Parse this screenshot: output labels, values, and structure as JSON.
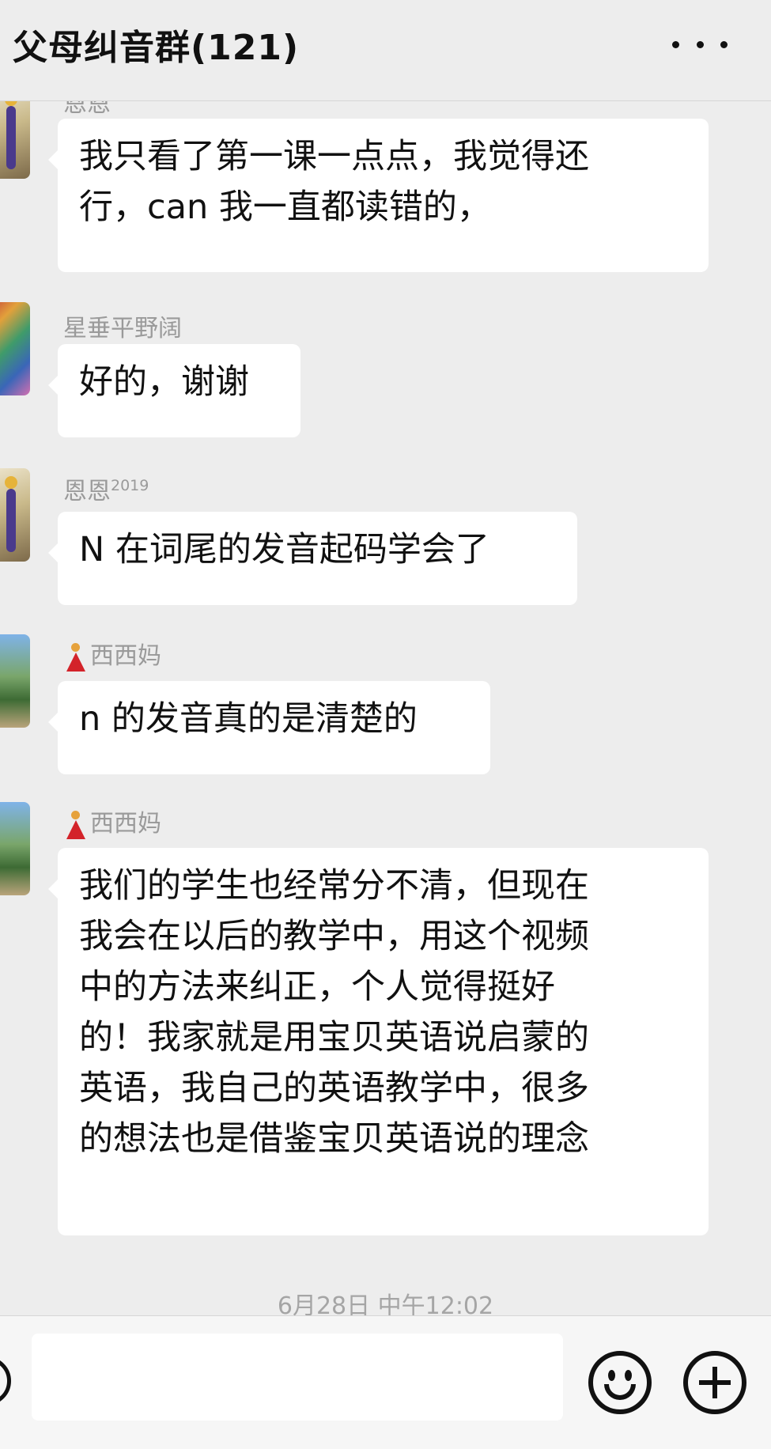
{
  "header": {
    "title": "父母纠音群(121)",
    "more_icon": "more-dots-icon"
  },
  "messages": [
    {
      "sender": "恩恩",
      "sender_sup": "",
      "sender_emoji": "",
      "text": "我只看了第一课一点点，我觉得还\n行，can 我一直都读错的，",
      "avatar": "avatar-figure"
    },
    {
      "sender": "星垂平野阔",
      "sender_sup": "",
      "sender_emoji": "",
      "text": "好的，谢谢",
      "avatar": "avatar-artwork"
    },
    {
      "sender": "恩恩",
      "sender_sup": "2019",
      "sender_emoji": "",
      "text": "N 在词尾的发音起码学会了",
      "avatar": "avatar-figure"
    },
    {
      "sender": "西西妈",
      "sender_sup": "",
      "sender_emoji": "dancer-emoji",
      "text": "n 的发音真的是清楚的",
      "avatar": "avatar-landscape"
    },
    {
      "sender": "西西妈",
      "sender_sup": "",
      "sender_emoji": "dancer-emoji",
      "text": "我们的学生也经常分不清，但现在\n我会在以后的教学中，用这个视频\n中的方法来纠正，个人觉得挺好\n的！我家就是用宝贝英语说启蒙的\n英语，我自己的英语教学中，很多\n的想法也是借鉴宝贝英语说的理念",
      "avatar": "avatar-landscape"
    }
  ],
  "timestamp": "6月28日 中午12:02",
  "input_bar": {
    "placeholder": "",
    "icons": [
      "voice-icon",
      "emoji-icon",
      "plus-icon"
    ]
  }
}
